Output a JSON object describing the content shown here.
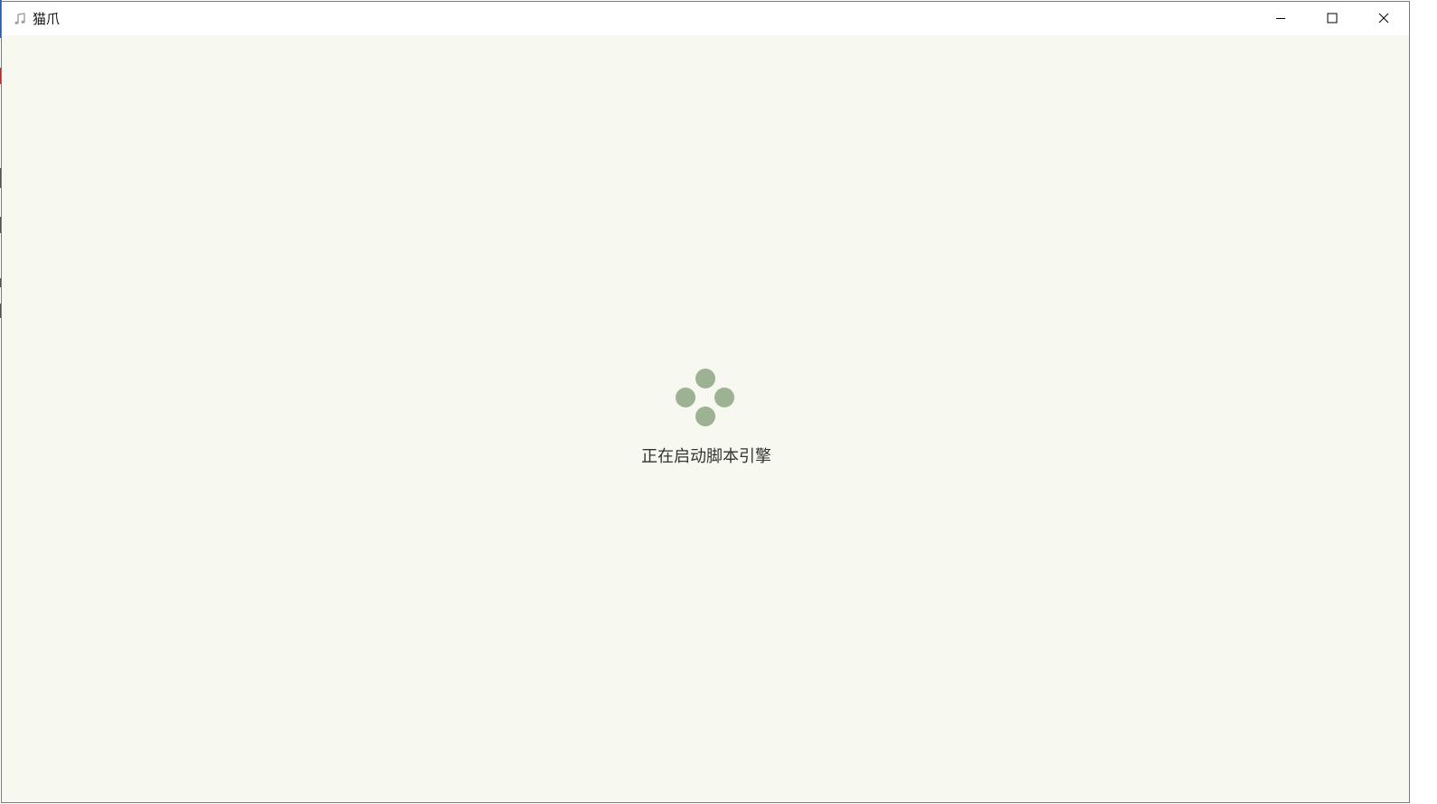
{
  "window": {
    "title": "猫爪",
    "icon": "music-note-icon",
    "controls": {
      "minimize": "minimize-icon",
      "maximize": "maximize-icon",
      "close": "close-icon"
    }
  },
  "main": {
    "status_text": "正在启动脚本引擎",
    "loader_color": "#9db193",
    "background_color": "#f7f8f0"
  }
}
